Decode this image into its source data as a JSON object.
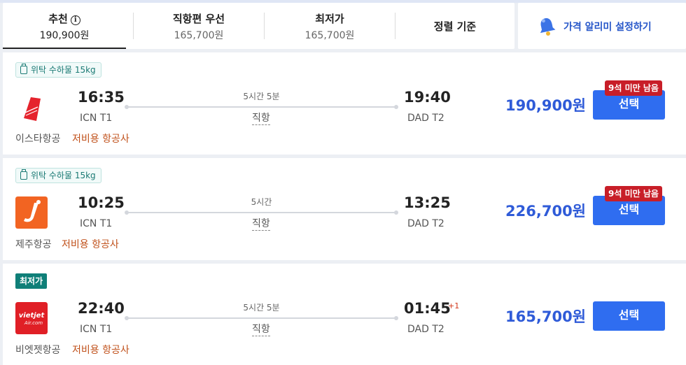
{
  "sort_tabs": [
    {
      "label": "추천",
      "price": "190,900원",
      "active": true
    },
    {
      "label": "직항편 우선",
      "price": "165,700원"
    },
    {
      "label": "최저가",
      "price": "165,700원"
    },
    {
      "label": "정렬 기준"
    }
  ],
  "price_alert": {
    "label": "가격 알리미 설정하기",
    "icon": "bell-icon"
  },
  "colors": {
    "accent_blue": "#2f6df0",
    "price_blue": "#2f5bd8",
    "seats_red": "#c81e28",
    "cheap_teal": "#0f7f78",
    "lcc_orange": "#c0501a"
  },
  "flights": [
    {
      "badge": "위탁 수하물 15kg",
      "airline": "이스타항공",
      "airline_type": "저비용 항공사",
      "logo": "eastar-jet-logo",
      "depart_time": "16:35",
      "depart_airport": "ICN T1",
      "duration": "5시간 5분",
      "stops": "직항",
      "arrive_time": "19:40",
      "arrive_airport": "DAD T2",
      "price": "190,900원",
      "select_label": "선택",
      "seats_left": "9석 미만 남음"
    },
    {
      "badge": "위탁 수하물 15kg",
      "airline": "제주항공",
      "airline_type": "저비용 항공사",
      "logo": "jeju-air-logo",
      "depart_time": "10:25",
      "depart_airport": "ICN T1",
      "duration": "5시간",
      "stops": "직항",
      "arrive_time": "13:25",
      "arrive_airport": "DAD T2",
      "price": "226,700원",
      "select_label": "선택",
      "seats_left": "9석 미만 남음"
    },
    {
      "badge": "최저가",
      "airline": "비엣젯항공",
      "airline_type": "저비용 항공사",
      "logo": "vietjet-air-logo",
      "logo_text_1": "vietjet",
      "logo_text_2": "Air.com",
      "depart_time": "22:40",
      "depart_airport": "ICN T1",
      "duration": "5시간 5분",
      "stops": "직항",
      "arrive_time": "01:45",
      "arrive_day_offset": "+1",
      "arrive_airport": "DAD T2",
      "price": "165,700원",
      "select_label": "선택"
    }
  ]
}
